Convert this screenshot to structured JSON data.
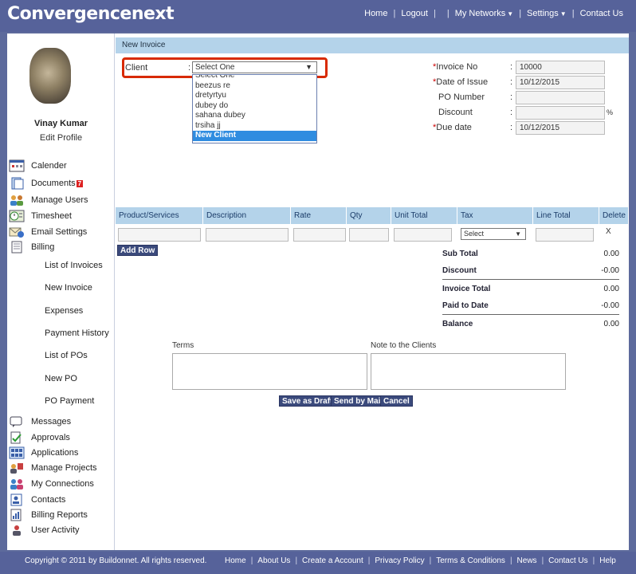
{
  "header": {
    "logo": "Convergencenext",
    "nav": [
      "Home",
      "Logout",
      "My Networks",
      "Settings",
      "Contact Us"
    ]
  },
  "profile": {
    "name": "Vinay Kumar",
    "edit_label": "Edit Profile"
  },
  "sidebar": {
    "items": [
      {
        "label": "Calender",
        "icon": "calendar-icon"
      },
      {
        "label": "Documents",
        "icon": "documents-icon",
        "badge": "7"
      },
      {
        "label": "Manage Users",
        "icon": "users-icon"
      },
      {
        "label": "Timesheet",
        "icon": "timesheet-icon"
      },
      {
        "label": "Email Settings",
        "icon": "email-settings-icon"
      },
      {
        "label": "Billing",
        "icon": "billing-icon"
      }
    ],
    "billing_sub": [
      "List of Invoices",
      "New Invoice",
      "Expenses",
      "Payment History",
      "List of POs",
      "New PO",
      "PO Payment"
    ],
    "items2": [
      {
        "label": "Messages",
        "icon": "messages-icon"
      },
      {
        "label": "Approvals",
        "icon": "approvals-icon"
      },
      {
        "label": "Applications",
        "icon": "applications-icon"
      },
      {
        "label": "Manage Projects",
        "icon": "projects-icon"
      },
      {
        "label": "My Connections",
        "icon": "connections-icon"
      },
      {
        "label": "Contacts",
        "icon": "contacts-icon"
      },
      {
        "label": "Billing Reports",
        "icon": "reports-icon"
      },
      {
        "label": "User Activity",
        "icon": "activity-icon"
      }
    ]
  },
  "form": {
    "title": "New Invoice",
    "client_label": "Client",
    "client_value": "Select One",
    "client_options": [
      "Select One",
      "beezus re",
      "dretyrtyu",
      "dubey do",
      "sahana dubey",
      "trsiha jj",
      "New Client"
    ],
    "client_selected_option": "New Client",
    "fields": [
      {
        "label": "Invoice No",
        "required": true,
        "value": "10000"
      },
      {
        "label": "Date of Issue",
        "required": true,
        "value": "10/12/2015"
      },
      {
        "label": "PO Number",
        "required": false,
        "value": ""
      },
      {
        "label": "Discount",
        "required": false,
        "value": "",
        "suffix": "%"
      },
      {
        "label": "Due date",
        "required": true,
        "value": "10/12/2015"
      }
    ]
  },
  "table": {
    "columns": [
      "Product/Services",
      "Description",
      "Rate",
      "Qty",
      "Unit Total",
      "Tax",
      "Line Total",
      "Delete"
    ],
    "tax_value": "Select",
    "delete_label": "X",
    "add_row": "Add Row"
  },
  "totals": [
    {
      "label": "Sub Total",
      "value": "0.00"
    },
    {
      "label": "Discount",
      "value": "-0.00"
    },
    {
      "label": "Invoice Total",
      "value": "0.00"
    },
    {
      "label": "Paid to Date",
      "value": "-0.00"
    },
    {
      "label": "Balance",
      "value": "0.00"
    }
  ],
  "notes": {
    "terms_label": "Terms",
    "client_note_label": "Note to the Clients"
  },
  "actions": {
    "save_draft": "Save as Draft",
    "send_mail": "Send by Mail",
    "cancel": "Cancel"
  },
  "footer": {
    "copyright": "Copyright © 2011 by Buildonnet. All rights reserved.",
    "links": [
      "Home",
      "About Us",
      "Create a Account",
      "Privacy Policy",
      "Terms & Conditions",
      "News",
      "Contact Us",
      "Help"
    ]
  },
  "colors": {
    "header_bg": "#56629a",
    "table_header_bg": "#b4d3ea",
    "highlight": "#d82a00",
    "selected_option": "#2f8ce0"
  }
}
